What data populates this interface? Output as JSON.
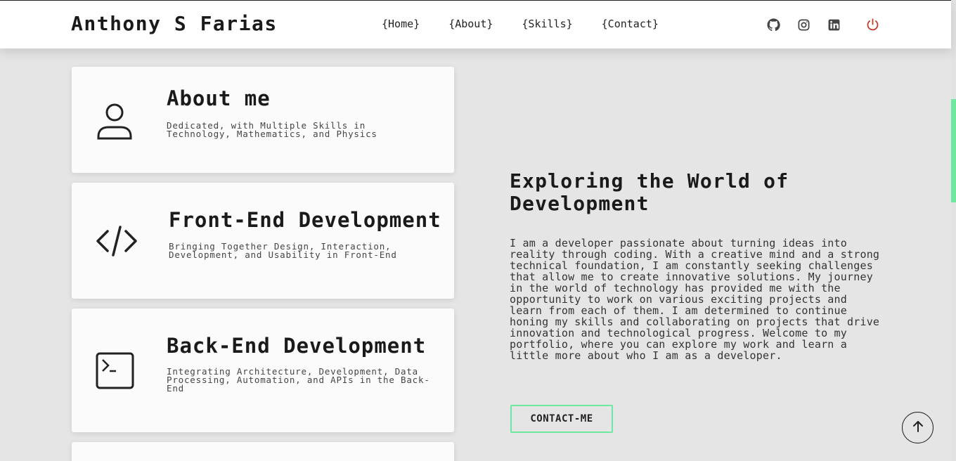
{
  "header": {
    "brand": "Anthony S Farias",
    "nav": [
      {
        "label": "{Home}"
      },
      {
        "label": "{About}"
      },
      {
        "label": "{Skills}"
      },
      {
        "label": "{Contact}"
      }
    ],
    "social_icons": [
      "github-icon",
      "instagram-icon",
      "linkedin-icon"
    ],
    "power_icon": "power-icon",
    "power_color": "#c0392b"
  },
  "cards": [
    {
      "icon": "user-icon",
      "title": "About me",
      "description": "Dedicated, with Multiple Skills in Technology, Mathematics, and Physics"
    },
    {
      "icon": "code-icon",
      "title": "Front-End Development",
      "description": "Bringing Together Design, Interaction, Development, and Usability in Front-End"
    },
    {
      "icon": "terminal-icon",
      "title": "Back-End Development",
      "description": "Integrating Architecture, Development, Data Processing, Automation, and APIs in the Back-End"
    }
  ],
  "hero": {
    "title": "Exploring the World of Development",
    "text": "I am a developer passionate about turning ideas into reality through coding. With a creative mind and a strong technical foundation, I am constantly seeking challenges that allow me to create innovative solutions. My journey in the world of technology has provided me with the opportunity to work on various exciting projects and learn from each of them. I am determined to continue honing my skills and collaborating on projects that drive innovation and technological progress. Welcome to my portfolio, where you can explore my work and learn a little more about who I am as a developer.",
    "button_label": "CONTACT-ME"
  },
  "scroll_top_icon": "arrow-up-icon",
  "accent_color": "#6ee7a0"
}
